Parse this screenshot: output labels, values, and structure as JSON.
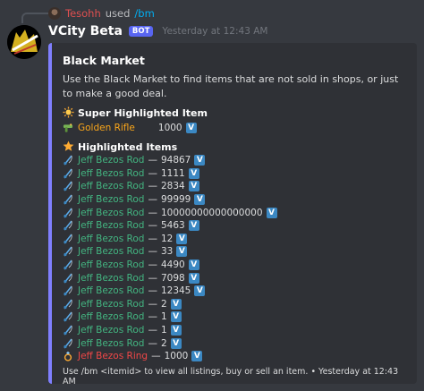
{
  "reply": {
    "user": "Tesohh",
    "used_label": "used",
    "command": "/bm"
  },
  "message": {
    "username": "VCity Beta",
    "bot_tag": "BOT",
    "timestamp": "Yesterday at 12:43 AM"
  },
  "embed": {
    "accent_color": "#7f7fff",
    "title": "Black Market",
    "description": "Use the Black Market to find items that are not sold in shops, or just to make a good deal.",
    "super_section": {
      "icon": "sun-icon",
      "title": "Super Highlighted Item"
    },
    "super_item": {
      "icon": "water-pistol-icon",
      "name": "Golden Rifle",
      "price": "1000",
      "badge": "V"
    },
    "highlighted_section": {
      "icon": "star-icon",
      "title": "Highlighted Items"
    },
    "items": [
      {
        "icon": "fishing-rod-icon",
        "name": "Jeff Bezos Rod",
        "sep": "—",
        "price": "94867",
        "badge": "V",
        "color": "green"
      },
      {
        "icon": "fishing-rod-icon",
        "name": "Jeff Bezos Rod",
        "sep": "—",
        "price": "1111",
        "badge": "V",
        "color": "green"
      },
      {
        "icon": "fishing-rod-icon",
        "name": "Jeff Bezos Rod",
        "sep": "—",
        "price": "2834",
        "badge": "V",
        "color": "green"
      },
      {
        "icon": "fishing-rod-icon",
        "name": "Jeff Bezos Rod",
        "sep": "—",
        "price": "99999",
        "badge": "V",
        "color": "green"
      },
      {
        "icon": "fishing-rod-icon",
        "name": "Jeff Bezos Rod",
        "sep": "—",
        "price": "10000000000000000",
        "badge": "V",
        "color": "green"
      },
      {
        "icon": "fishing-rod-icon",
        "name": "Jeff Bezos Rod",
        "sep": "—",
        "price": "5463",
        "badge": "V",
        "color": "green"
      },
      {
        "icon": "fishing-rod-icon",
        "name": "Jeff Bezos Rod",
        "sep": "—",
        "price": "12",
        "badge": "V",
        "color": "green"
      },
      {
        "icon": "fishing-rod-icon",
        "name": "Jeff Bezos Rod",
        "sep": "—",
        "price": "33",
        "badge": "V",
        "color": "green"
      },
      {
        "icon": "fishing-rod-icon",
        "name": "Jeff Bezos Rod",
        "sep": "—",
        "price": "4490",
        "badge": "V",
        "color": "green"
      },
      {
        "icon": "fishing-rod-icon",
        "name": "Jeff Bezos Rod",
        "sep": "—",
        "price": "7098",
        "badge": "V",
        "color": "green"
      },
      {
        "icon": "fishing-rod-icon",
        "name": "Jeff Bezos Rod",
        "sep": "—",
        "price": "12345",
        "badge": "V",
        "color": "green"
      },
      {
        "icon": "fishing-rod-icon",
        "name": "Jeff Bezos Rod",
        "sep": "—",
        "price": "2",
        "badge": "V",
        "color": "green"
      },
      {
        "icon": "fishing-rod-icon",
        "name": "Jeff Bezos Rod",
        "sep": "—",
        "price": "1",
        "badge": "V",
        "color": "green"
      },
      {
        "icon": "fishing-rod-icon",
        "name": "Jeff Bezos Rod",
        "sep": "—",
        "price": "1",
        "badge": "V",
        "color": "green"
      },
      {
        "icon": "fishing-rod-icon",
        "name": "Jeff Bezos Rod",
        "sep": "—",
        "price": "2",
        "badge": "V",
        "color": "green"
      },
      {
        "icon": "ring-icon",
        "name": "Jeff Bezos Ring",
        "sep": "—",
        "price": "1000",
        "badge": "V",
        "color": "red"
      }
    ],
    "footer": "Use /bm <itemid> to view all listings, buy or sell an item. • Yesterday at 12:43 AM"
  }
}
